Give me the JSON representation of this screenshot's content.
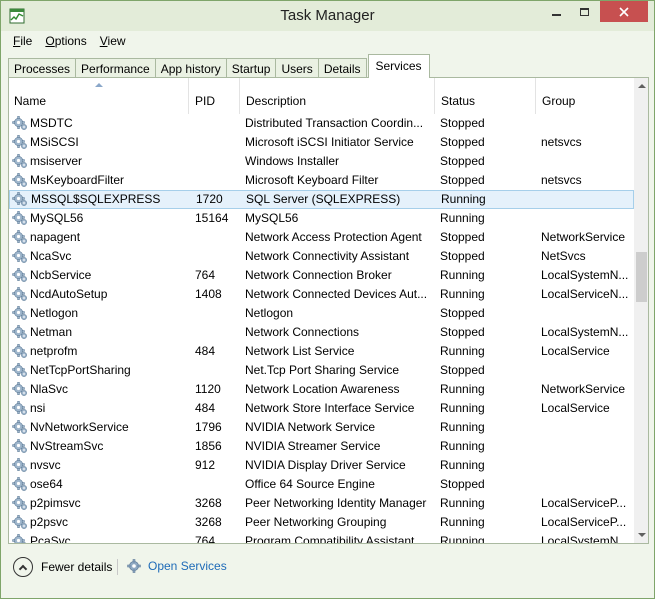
{
  "window": {
    "title": "Task Manager"
  },
  "menu": [
    {
      "label_ul": "F",
      "label_rest": "ile"
    },
    {
      "label_ul": "O",
      "label_rest": "ptions"
    },
    {
      "label_ul": "V",
      "label_rest": "iew"
    }
  ],
  "tabs": [
    "Processes",
    "Performance",
    "App history",
    "Startup",
    "Users",
    "Details",
    "Services"
  ],
  "active_tab": "Services",
  "columns": {
    "name": "Name",
    "pid": "PID",
    "description": "Description",
    "status": "Status",
    "group": "Group"
  },
  "rows": [
    {
      "name": "MSDTC",
      "pid": "",
      "description": "Distributed Transaction Coordin...",
      "status": "Stopped",
      "group": ""
    },
    {
      "name": "MSiSCSI",
      "pid": "",
      "description": "Microsoft iSCSI Initiator Service",
      "status": "Stopped",
      "group": "netsvcs"
    },
    {
      "name": "msiserver",
      "pid": "",
      "description": "Windows Installer",
      "status": "Stopped",
      "group": ""
    },
    {
      "name": "MsKeyboardFilter",
      "pid": "",
      "description": "Microsoft Keyboard Filter",
      "status": "Stopped",
      "group": "netsvcs"
    },
    {
      "name": "MSSQL$SQLEXPRESS",
      "pid": "1720",
      "description": "SQL Server (SQLEXPRESS)",
      "status": "Running",
      "group": "",
      "selected": true
    },
    {
      "name": "MySQL56",
      "pid": "15164",
      "description": "MySQL56",
      "status": "Running",
      "group": ""
    },
    {
      "name": "napagent",
      "pid": "",
      "description": "Network Access Protection Agent",
      "status": "Stopped",
      "group": "NetworkService"
    },
    {
      "name": "NcaSvc",
      "pid": "",
      "description": "Network Connectivity Assistant",
      "status": "Stopped",
      "group": "NetSvcs"
    },
    {
      "name": "NcbService",
      "pid": "764",
      "description": "Network Connection Broker",
      "status": "Running",
      "group": "LocalSystemN..."
    },
    {
      "name": "NcdAutoSetup",
      "pid": "1408",
      "description": "Network Connected Devices Aut...",
      "status": "Running",
      "group": "LocalServiceN..."
    },
    {
      "name": "Netlogon",
      "pid": "",
      "description": "Netlogon",
      "status": "Stopped",
      "group": ""
    },
    {
      "name": "Netman",
      "pid": "",
      "description": "Network Connections",
      "status": "Stopped",
      "group": "LocalSystemN..."
    },
    {
      "name": "netprofm",
      "pid": "484",
      "description": "Network List Service",
      "status": "Running",
      "group": "LocalService"
    },
    {
      "name": "NetTcpPortSharing",
      "pid": "",
      "description": "Net.Tcp Port Sharing Service",
      "status": "Stopped",
      "group": ""
    },
    {
      "name": "NlaSvc",
      "pid": "1120",
      "description": "Network Location Awareness",
      "status": "Running",
      "group": "NetworkService"
    },
    {
      "name": "nsi",
      "pid": "484",
      "description": "Network Store Interface Service",
      "status": "Running",
      "group": "LocalService"
    },
    {
      "name": "NvNetworkService",
      "pid": "1796",
      "description": "NVIDIA Network Service",
      "status": "Running",
      "group": ""
    },
    {
      "name": "NvStreamSvc",
      "pid": "1856",
      "description": "NVIDIA Streamer Service",
      "status": "Running",
      "group": ""
    },
    {
      "name": "nvsvc",
      "pid": "912",
      "description": "NVIDIA Display Driver Service",
      "status": "Running",
      "group": ""
    },
    {
      "name": "ose64",
      "pid": "",
      "description": "Office 64 Source Engine",
      "status": "Stopped",
      "group": ""
    },
    {
      "name": "p2pimsvc",
      "pid": "3268",
      "description": "Peer Networking Identity Manager",
      "status": "Running",
      "group": "LocalServiceP..."
    },
    {
      "name": "p2psvc",
      "pid": "3268",
      "description": "Peer Networking Grouping",
      "status": "Running",
      "group": "LocalServiceP..."
    },
    {
      "name": "PcaSvc",
      "pid": "764",
      "description": "Program Compatibility Assistant ...",
      "status": "Running",
      "group": "LocalSystemN..."
    }
  ],
  "footer": {
    "fewer_details": "Fewer details",
    "open_services": "Open Services"
  },
  "colors": {
    "accent": "#1e6bb8",
    "frame": "#7fa56a",
    "close_button": "#c75050",
    "selection": "#e5f1fb"
  }
}
